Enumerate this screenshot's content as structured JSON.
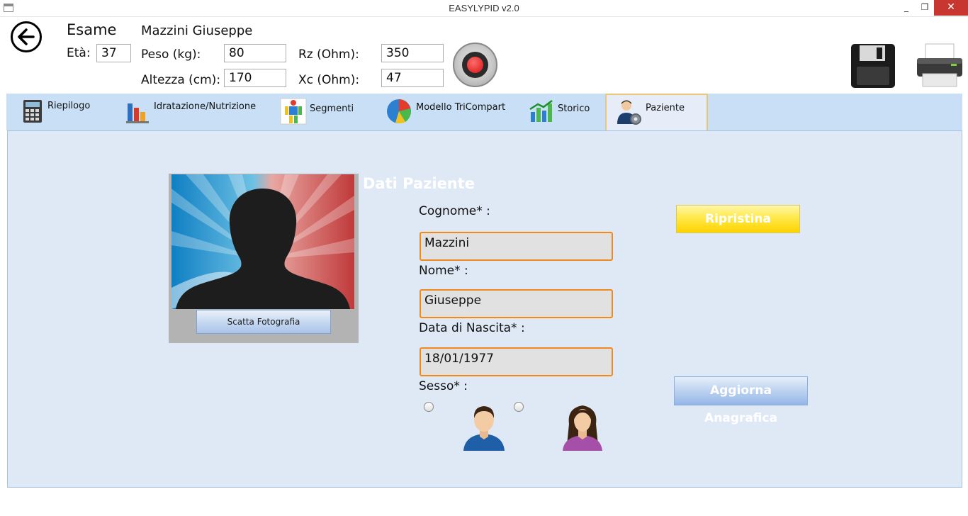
{
  "window": {
    "title": "EASYLYPID v2.0",
    "minimize": "_",
    "maximize": "❐",
    "close": "✕"
  },
  "header": {
    "exam_label": "Esame",
    "patient_name": "Mazzini Giuseppe",
    "eta_label": "Età:",
    "eta_value": "37",
    "peso_label": "Peso (kg):",
    "peso_value": "80",
    "altezza_label": "Altezza (cm):",
    "altezza_value": "170",
    "rz_label": "Rz (Ohm):",
    "rz_value": "350",
    "xc_label": "Xc (Ohm):",
    "xc_value": "47"
  },
  "tabs": [
    {
      "label": "Riepilogo",
      "icon": "calculator-icon"
    },
    {
      "label": "Idratazione/Nutrizione",
      "icon": "bar-chart-icon"
    },
    {
      "label": "Segmenti",
      "icon": "body-segments-icon"
    },
    {
      "label": "Modello TriCompart",
      "icon": "pie-chart-icon"
    },
    {
      "label": "Storico",
      "icon": "history-chart-icon"
    },
    {
      "label": "Paziente",
      "icon": "patient-icon",
      "active": true
    }
  ],
  "patient": {
    "section_title": "Dati Paziente",
    "photo_button": "Scatta Fotografia",
    "cognome_label": "Cognome* :",
    "cognome_value": "Mazzini",
    "nome_label": "Nome* :",
    "nome_value": "Giuseppe",
    "nascita_label": "Data di Nascita* :",
    "nascita_value": "18/01/1977",
    "sesso_label": "Sesso* :",
    "ripristina_button": "Ripristina",
    "aggiorna_button": "Aggiorna Anagrafica"
  },
  "colors": {
    "tabbar": "#c9dff5",
    "panel": "#dfe9f6",
    "input_border": "#f08a1c",
    "record_dot": "#d41313"
  }
}
